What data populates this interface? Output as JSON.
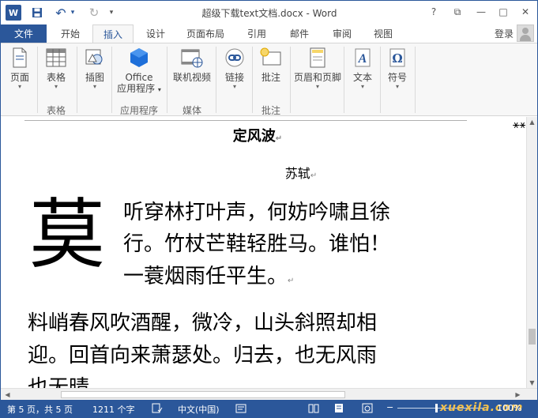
{
  "titlebar": {
    "app_icon": "W",
    "title": "超级下载text文档.docx - Word",
    "help": "?",
    "restore_ribbon": "⧉",
    "minimize": "—",
    "maximize": "□",
    "close": "✕",
    "undo": "↶",
    "redo": "↻",
    "customize": "▾"
  },
  "tabs": {
    "file": "文件",
    "items": [
      "开始",
      "插入",
      "设计",
      "页面布局",
      "引用",
      "邮件",
      "审阅",
      "视图"
    ],
    "active": "插入",
    "login": "登录"
  },
  "ribbon": {
    "buttons": {
      "pages": "页面",
      "table": "表格",
      "illustrations": "插图",
      "office": "Office",
      "apps": "应用程序",
      "online_video": "联机视频",
      "links": "链接",
      "comment": "批注",
      "header_footer": "页眉和页脚",
      "text": "文本",
      "symbols": "符号"
    },
    "groups": {
      "tables": "表格",
      "apps": "应用程序",
      "media": "媒体",
      "comments": "批注"
    },
    "arrow": "▾"
  },
  "document": {
    "title": "定风波",
    "author": "苏轼",
    "dropcap": "莫",
    "line1": "听穿林打叶声，何妨吟啸且徐",
    "line2": "行。竹杖芒鞋轻胜马。谁怕！",
    "line3": "一蓑烟雨任平生。",
    "line4": "料峭春风吹酒醒，微冷，山头斜照却相",
    "line5": "迎。回首向来萧瑟处。归去，也无风雨",
    "line6": "也无晴。",
    "para_mark": "↵",
    "border_glyphs": "⚹⚹⚹⚹⚹⚹⚹⚹⚹⚹⚹⚹⚹⚹⚹⚹⚹"
  },
  "statusbar": {
    "page": "第 5 页，共 5 页",
    "words": "1211 个字",
    "language": "中文(中国)",
    "zoom": "100%",
    "watermark": "xuexila.com"
  },
  "colors": {
    "accent": "#2b579a",
    "ribbon_bg": "#f7f7f7"
  }
}
